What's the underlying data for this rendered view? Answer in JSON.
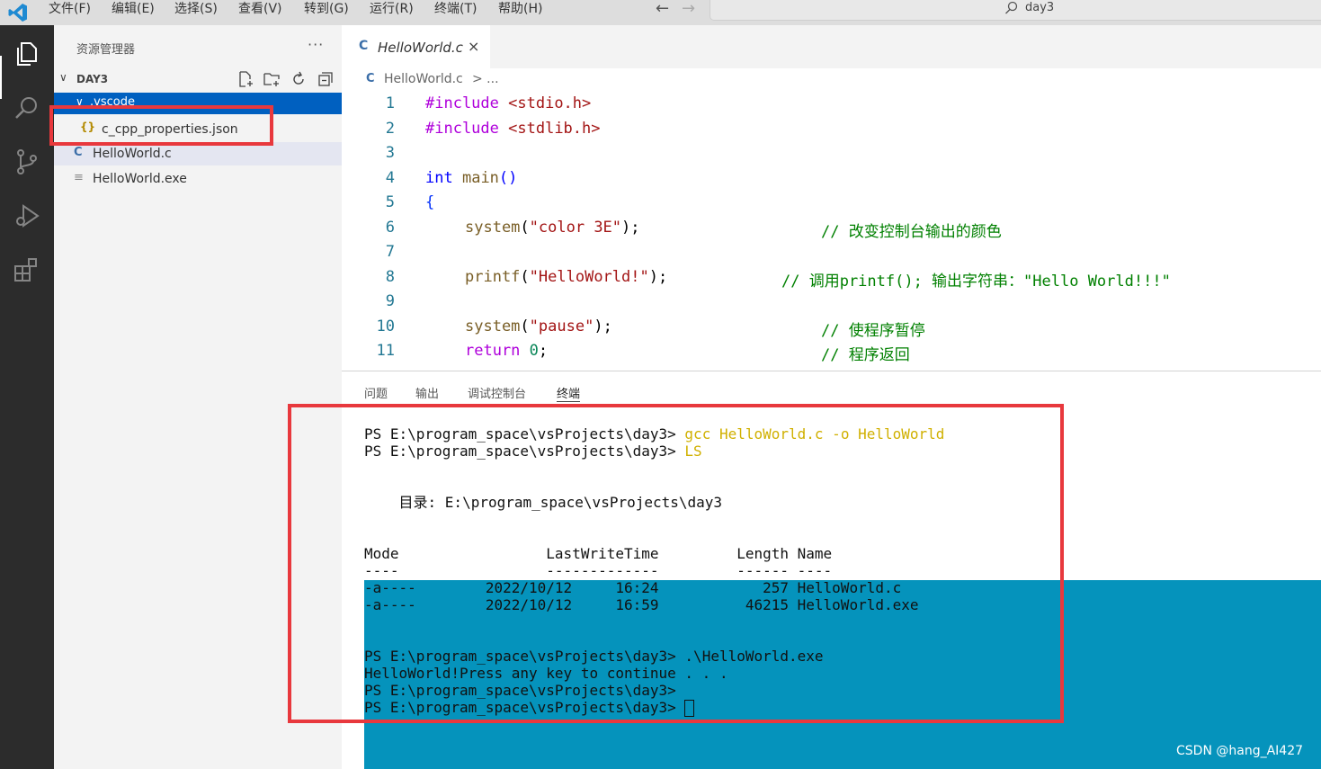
{
  "menu": [
    "文件(F)",
    "编辑(E)",
    "选择(S)",
    "查看(V)",
    "转到(G)",
    "运行(R)",
    "终端(T)",
    "帮助(H)"
  ],
  "search": {
    "text": "day3"
  },
  "sidebar": {
    "title": "资源管理器",
    "more": "···",
    "folder": "DAY3",
    "items": [
      {
        "label": ".vscode",
        "selected": true
      },
      {
        "label": "c_cpp_properties.json"
      },
      {
        "label": "HelloWorld.c"
      },
      {
        "label": "HelloWorld.exe"
      }
    ],
    "chevron": "∨",
    "vscode_chevron": "∨"
  },
  "editor": {
    "tab": "HelloWorld.c",
    "tab_icon": "C",
    "tab_close": "×",
    "breadcrumb_file": "HelloWorld.c",
    "breadcrumb_rest": "> ...",
    "line_numbers": [
      "1",
      "2",
      "3",
      "4",
      "5",
      "6",
      "7",
      "8",
      "9",
      "10",
      "11"
    ]
  },
  "code": {
    "l1_pre": "#include",
    "l1_inc": "<stdio.h>",
    "l2_pre": "#include",
    "l2_inc": "<stdlib.h>",
    "l4_type": "int",
    "l4_fn": "main",
    "l4_paren": "()",
    "l5": "{",
    "l6_fn": "system",
    "l6_str": "\"color 3E\"",
    "l6_cm": "// 改变控制台输出的颜色",
    "l8_fn": "printf",
    "l8_str": "\"HelloWorld!\"",
    "l8_cm": "// 调用printf(); 输出字符串：\"Hello World!!!\"",
    "l10_fn": "system",
    "l10_str": "\"pause\"",
    "l10_cm": "// 使程序暂停",
    "l11_kw": "return",
    "l11_num": "0",
    "l11_cm": "// 程序返回"
  },
  "panel": {
    "tabs": [
      "问题",
      "输出",
      "调试控制台",
      "终端"
    ]
  },
  "terminal": {
    "prompt": "PS E:\\program_space\\vsProjects\\day3>",
    "cmd1": "gcc HelloWorld.c -o HelloWorld",
    "cmd2": "LS",
    "dir_line": "    目录: E:\\program_space\\vsProjects\\day3",
    "header": "Mode                 LastWriteTime         Length Name",
    "underline": "----                 -------------         ------ ----",
    "row1": "-a----        2022/10/12     16:24            257 HelloWorld.c",
    "row2": "-a----        2022/10/12     16:59          46215 HelloWorld.exe",
    "cmd3": ".\\HelloWorld.exe",
    "output": "HelloWorld!Press any key to continue . . ."
  },
  "watermark": "CSDN @hang_AI427",
  "colors": {
    "accent": "#0060c0",
    "highlight": "#e8383d",
    "terminal_bg": "#0593bc"
  }
}
